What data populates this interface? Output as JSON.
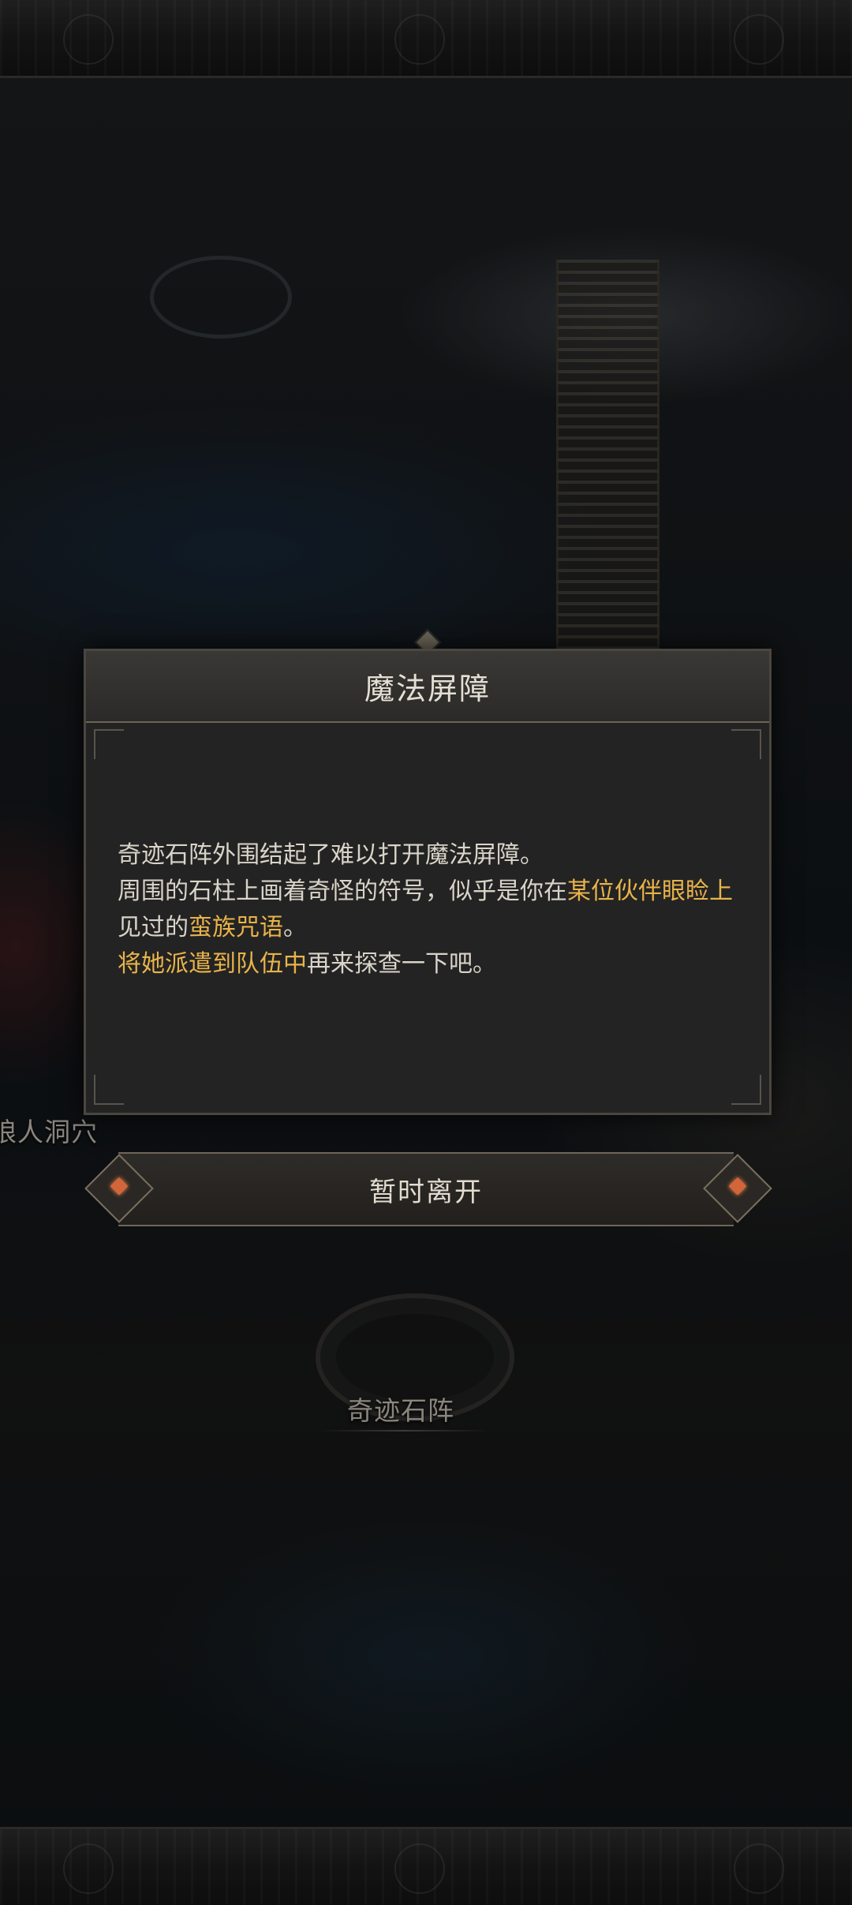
{
  "map": {
    "labels": {
      "cave": "狼人洞穴",
      "stone_circle": "奇迹石阵"
    }
  },
  "dialog": {
    "title": "魔法屏障",
    "body": {
      "line1": "奇迹石阵外围结起了难以打开魔法屏障。",
      "line2_before": "周围的石柱上画着奇怪的符号，似乎是你在",
      "line2_highlight": "某位伙伴眼睑上",
      "line2_after": "见过的",
      "line2_highlight2": "蛮族咒语",
      "line2_end": "。",
      "line3_highlight": "将她派遣到队伍中",
      "line3_after": "再来探查一下吧。"
    }
  },
  "actions": {
    "leave_label": "暂时离开"
  },
  "colors": {
    "highlight": "#e8b34a",
    "text": "#d9d4c9",
    "panel": "#232323"
  }
}
